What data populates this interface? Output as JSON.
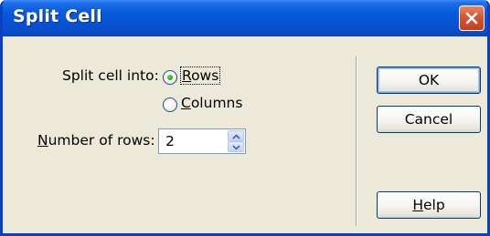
{
  "window": {
    "title": "Split Cell"
  },
  "icons": {
    "close": "close-icon",
    "spin_up": "chevron-up-icon",
    "spin_down": "chevron-down-icon"
  },
  "split": {
    "label": "Split cell into:",
    "options": [
      {
        "prefix": "",
        "mnemonic": "R",
        "rest": "ows",
        "selected": true
      },
      {
        "prefix": "",
        "mnemonic": "C",
        "rest": "olumns",
        "selected": false
      }
    ]
  },
  "rows_field": {
    "label_mnemonic": "N",
    "label_rest": "umber of rows:",
    "value": "2"
  },
  "buttons": {
    "ok": "OK",
    "cancel": "Cancel",
    "help_mnemonic": "H",
    "help_rest": "elp"
  },
  "colors": {
    "titlebar": "#0553d6",
    "dialog_bg": "#ece9d8",
    "close_button": "#d8542c",
    "radio_selected": "#21a121"
  }
}
